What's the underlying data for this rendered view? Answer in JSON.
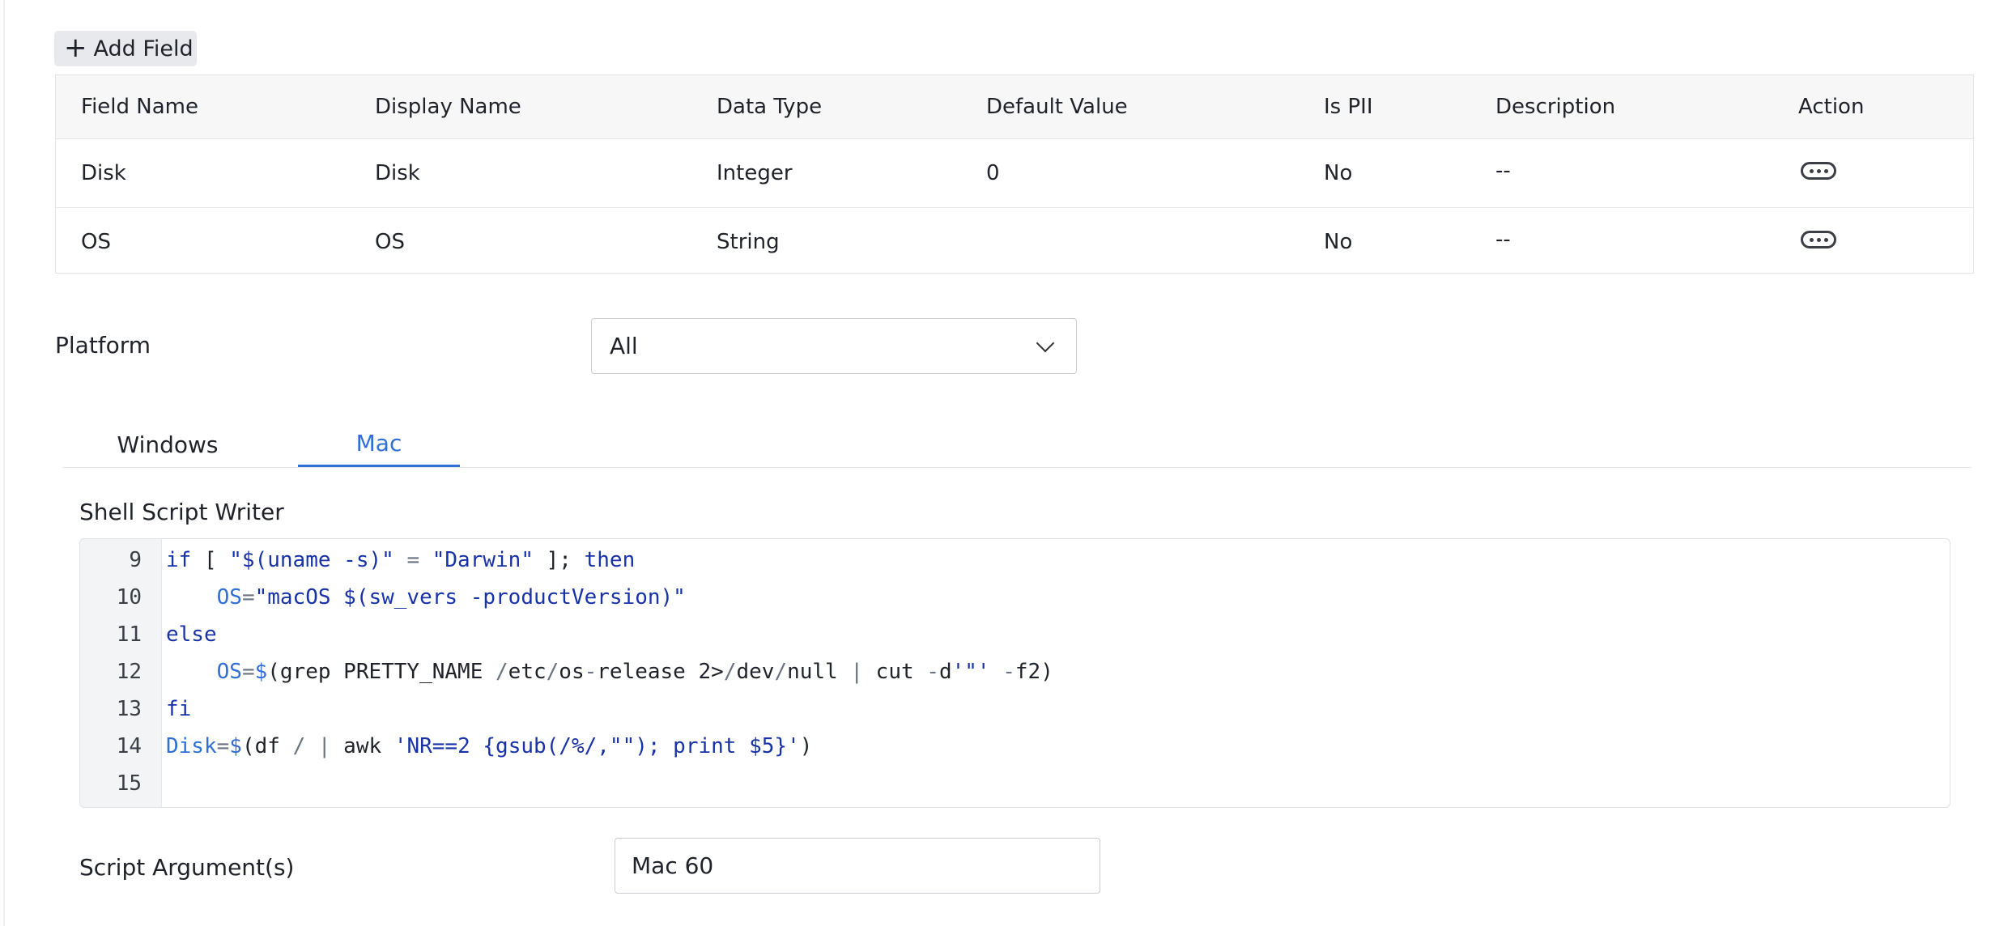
{
  "toolbar": {
    "add_field_label": "Add Field"
  },
  "table": {
    "headers": [
      "Field Name",
      "Display Name",
      "Data Type",
      "Default Value",
      "Is PII",
      "Description",
      "Action"
    ],
    "rows": [
      {
        "field_name": "Disk",
        "display_name": "Disk",
        "data_type": "Integer",
        "default_value": "0",
        "is_pii": "No",
        "description": "--"
      },
      {
        "field_name": "OS",
        "display_name": "OS",
        "data_type": "String",
        "default_value": "",
        "is_pii": "No",
        "description": "--"
      }
    ]
  },
  "platform": {
    "label": "Platform",
    "selected": "All"
  },
  "tabs": [
    {
      "label": "Windows",
      "active": false
    },
    {
      "label": "Mac",
      "active": true
    }
  ],
  "editor": {
    "label": "Shell Script Writer",
    "line_numbers": [
      "9",
      "10",
      "11",
      "12",
      "13",
      "14",
      "15"
    ],
    "lines": [
      "if [ \"$(uname -s)\" = \"Darwin\" ]; then",
      "    OS=\"macOS $(sw_vers -productVersion)\"",
      "else",
      "    OS=$(grep PRETTY_NAME /etc/os-release 2>/dev/null | cut -d'\"' -f2)",
      "fi",
      "Disk=$(df / | awk 'NR==2 {gsub(/%/,\"\"); print $5}')",
      ""
    ]
  },
  "script_args": {
    "label": "Script Argument(s)",
    "value": "Mac 60"
  },
  "colors": {
    "accent": "#2f6fd6",
    "keyword": "#1832a8"
  }
}
